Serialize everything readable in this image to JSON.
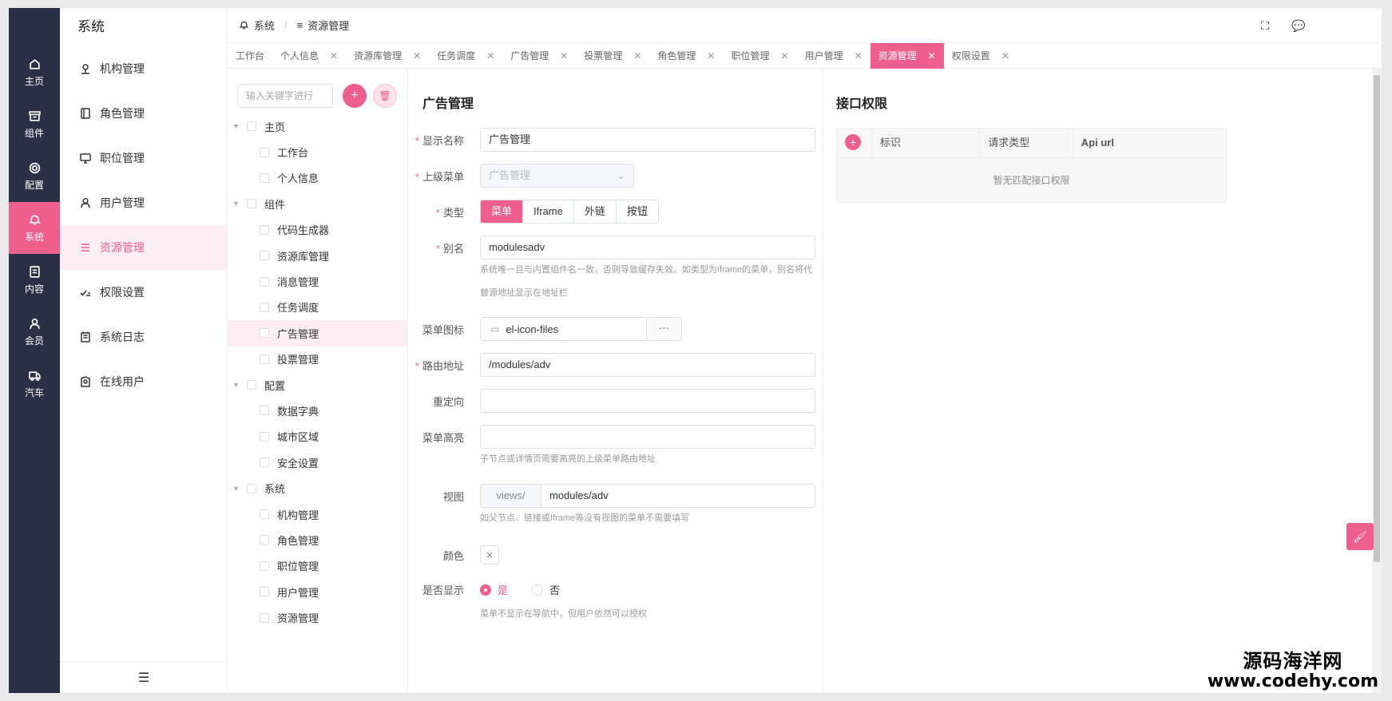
{
  "rail": [
    {
      "label": "主页",
      "icon": "home-icon"
    },
    {
      "label": "组件",
      "icon": "box-icon"
    },
    {
      "label": "配置",
      "icon": "gear-icon"
    },
    {
      "label": "系统",
      "icon": "bell-icon",
      "active": true
    },
    {
      "label": "内容",
      "icon": "document-icon"
    },
    {
      "label": "会员",
      "icon": "user-icon"
    },
    {
      "label": "汽车",
      "icon": "truck-icon"
    }
  ],
  "sub": {
    "title": "系统",
    "items": [
      {
        "label": "机构管理",
        "icon": "org-icon"
      },
      {
        "label": "角色管理",
        "icon": "role-icon"
      },
      {
        "label": "职位管理",
        "icon": "monitor-icon"
      },
      {
        "label": "用户管理",
        "icon": "user-icon"
      },
      {
        "label": "资源管理",
        "icon": "list-icon",
        "active": true
      },
      {
        "label": "权限设置",
        "icon": "check-icon"
      },
      {
        "label": "系统日志",
        "icon": "log-icon"
      },
      {
        "label": "在线用户",
        "icon": "online-icon"
      }
    ]
  },
  "breadcrumb": {
    "first": "系统",
    "second": "资源管理"
  },
  "tabs": [
    {
      "label": "工作台",
      "closable": false
    },
    {
      "label": "个人信息",
      "closable": true
    },
    {
      "label": "资源库管理",
      "closable": true
    },
    {
      "label": "任务调度",
      "closable": true
    },
    {
      "label": "广告管理",
      "closable": true
    },
    {
      "label": "投票管理",
      "closable": true
    },
    {
      "label": "角色管理",
      "closable": true
    },
    {
      "label": "职位管理",
      "closable": true
    },
    {
      "label": "用户管理",
      "closable": true
    },
    {
      "label": "资源管理",
      "closable": true,
      "active": true
    },
    {
      "label": "权限设置",
      "closable": true
    }
  ],
  "tree": {
    "search_placeholder": "输入关键字进行",
    "nodes": [
      {
        "label": "主页",
        "level": 0
      },
      {
        "label": "工作台",
        "level": 1
      },
      {
        "label": "个人信息",
        "level": 1
      },
      {
        "label": "组件",
        "level": 0
      },
      {
        "label": "代码生成器",
        "level": 1
      },
      {
        "label": "资源库管理",
        "level": 1
      },
      {
        "label": "消息管理",
        "level": 1
      },
      {
        "label": "任务调度",
        "level": 1
      },
      {
        "label": "广告管理",
        "level": 1,
        "active": true
      },
      {
        "label": "投票管理",
        "level": 1
      },
      {
        "label": "配置",
        "level": 0
      },
      {
        "label": "数据字典",
        "level": 1
      },
      {
        "label": "城市区域",
        "level": 1
      },
      {
        "label": "安全设置",
        "level": 1
      },
      {
        "label": "系统",
        "level": 0
      },
      {
        "label": "机构管理",
        "level": 1
      },
      {
        "label": "角色管理",
        "level": 1
      },
      {
        "label": "职位管理",
        "level": 1
      },
      {
        "label": "用户管理",
        "level": 1
      },
      {
        "label": "资源管理",
        "level": 1
      }
    ]
  },
  "form": {
    "title": "广告管理",
    "display_name": {
      "label": "显示名称",
      "value": "广告管理"
    },
    "parent_menu": {
      "label": "上级菜单",
      "value": "广告管理"
    },
    "type": {
      "label": "类型",
      "options": [
        "菜单",
        "Iframe",
        "外链",
        "按钮"
      ],
      "selected": "菜单"
    },
    "alias": {
      "label": "别名",
      "value": "modulesadv",
      "hint_line1": "系统唯一且与内置组件名一致，否则导致缓存失效。如类型为Iframe的菜单，别名将代",
      "hint_line2": "替源地址显示在地址栏"
    },
    "menu_icon": {
      "label": "菜单图标",
      "value": "el-icon-files",
      "more": "···"
    },
    "route": {
      "label": "路由地址",
      "value": "/modules/adv"
    },
    "redirect": {
      "label": "重定向",
      "value": ""
    },
    "highlight": {
      "label": "菜单高亮",
      "value": "",
      "hint": "子节点或详情页需要高亮的上级菜单路由地址"
    },
    "view": {
      "label": "视图",
      "prefix": "views/",
      "value": "modules/adv",
      "hint": "如父节点、链接或Iframe等没有视图的菜单不需要填写"
    },
    "color": {
      "label": "颜色"
    },
    "visible": {
      "label": "是否显示",
      "yes": "是",
      "no": "否",
      "selected": "是",
      "hint": "菜单不显示在导航中，但用户依然可以授权"
    }
  },
  "api": {
    "title": "接口权限",
    "columns": [
      "标识",
      "请求类型",
      "Api url"
    ],
    "empty": "暂无匹配接口权限"
  },
  "watermark": {
    "line1": "源码海洋网",
    "line2": "www.codehy.com"
  },
  "colors": {
    "accent": "#ee5f8d",
    "rail": "#2a3046"
  }
}
